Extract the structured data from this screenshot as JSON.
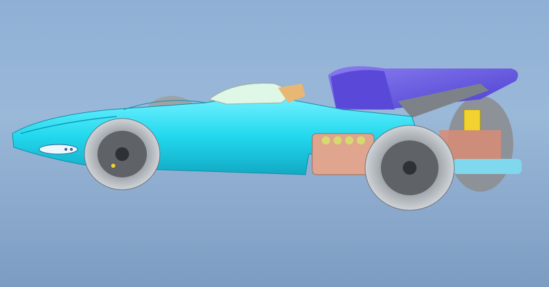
{
  "viewport": {
    "background_top": "#8fb0d6",
    "background_bottom": "#7d9cc2"
  },
  "model": {
    "subject": "formula-race-car-cad-model",
    "colors": {
      "body": "#22d8ee",
      "rear_wing": "#7b6ce8",
      "tires": "#b5b9bd",
      "wheels": "#5f6368",
      "engine": "#e0a58f",
      "cockpit": "#dff7e6",
      "accent_yellow": "#f2d22e"
    }
  }
}
